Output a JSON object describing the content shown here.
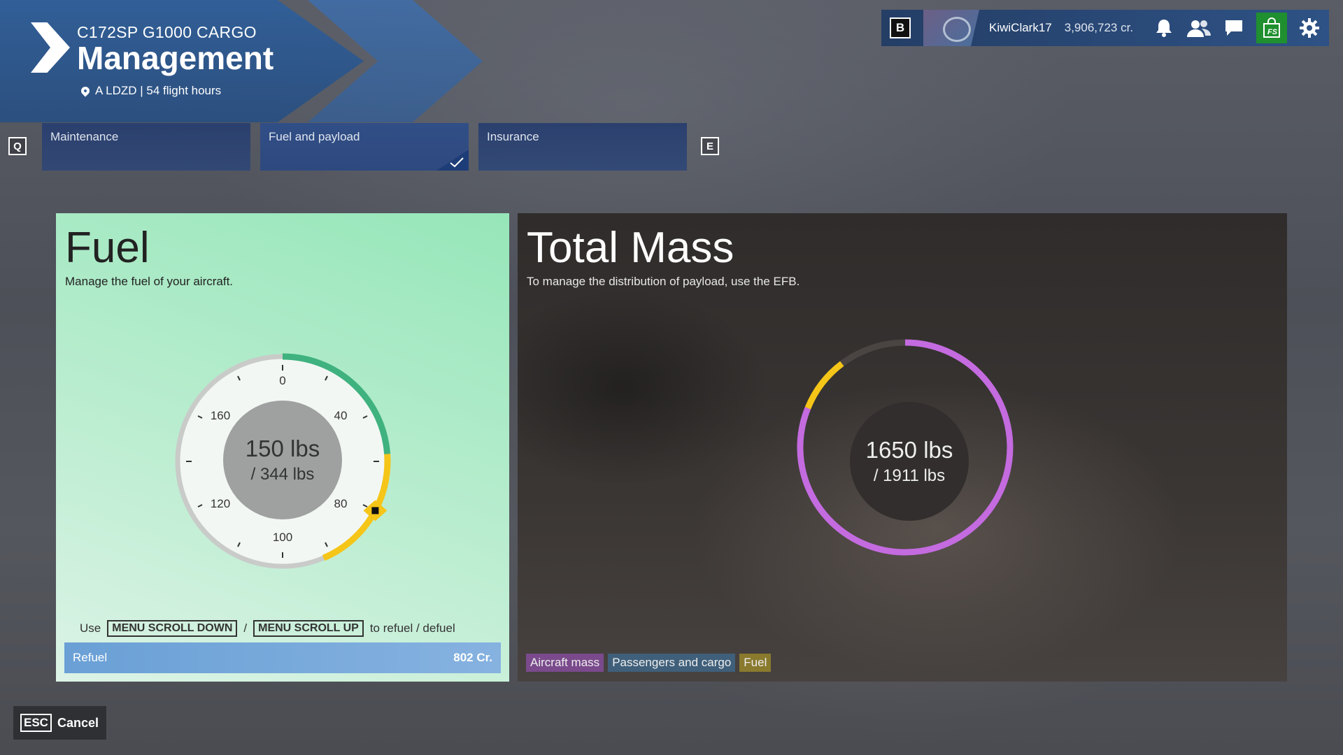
{
  "header": {
    "aircraft": "C172SP G1000 CARGO",
    "title": "Management",
    "location": "A LDZD | 54 flight hours"
  },
  "userbar": {
    "key_b": "B",
    "username": "KiwiClark17",
    "credits": "3,906,723 cr.",
    "icons": [
      "bell-icon",
      "friends-icon",
      "chat-icon",
      "store-icon",
      "gear-icon"
    ],
    "store_accent": "#1f8f2f"
  },
  "tabs": {
    "prev_key": "Q",
    "next_key": "E",
    "items": [
      {
        "label": "Maintenance",
        "active": false
      },
      {
        "label": "Fuel and payload",
        "active": true
      },
      {
        "label": "Insurance",
        "active": false
      }
    ]
  },
  "fuel": {
    "title": "Fuel",
    "subtitle": "Manage the fuel of your aircraft.",
    "current": "150 lbs",
    "max": "/ 344 lbs",
    "ticks": [
      "0",
      "40",
      "80",
      "100",
      "120",
      "160"
    ],
    "current_fraction": 0.436,
    "hint_use": "Use",
    "hint_key1": "MENU SCROLL DOWN",
    "hint_sep": "/",
    "hint_key2": "MENU SCROLL UP",
    "hint_tail": "to refuel / defuel",
    "refuel_label": "Refuel",
    "refuel_cost": "802 Cr.",
    "colors": {
      "full": "#3fb27f",
      "selection": "#f5c518",
      "track": "#c9cbc9"
    }
  },
  "mass": {
    "title": "Total Mass",
    "subtitle": "To manage the distribution of payload, use the EFB.",
    "current": "1650 lbs",
    "max": "/ 1911 lbs",
    "legend": [
      {
        "label": "Aircraft mass",
        "color": "#7a4a8c"
      },
      {
        "label": "Passengers and cargo",
        "color": "#3f5f7a"
      },
      {
        "label": "Fuel",
        "color": "#8a7a2e"
      }
    ],
    "ring": {
      "aircraft_color": "#c46be0",
      "fuel_color": "#f5c518"
    }
  },
  "footer": {
    "esc_key": "ESC",
    "cancel_label": "Cancel"
  }
}
